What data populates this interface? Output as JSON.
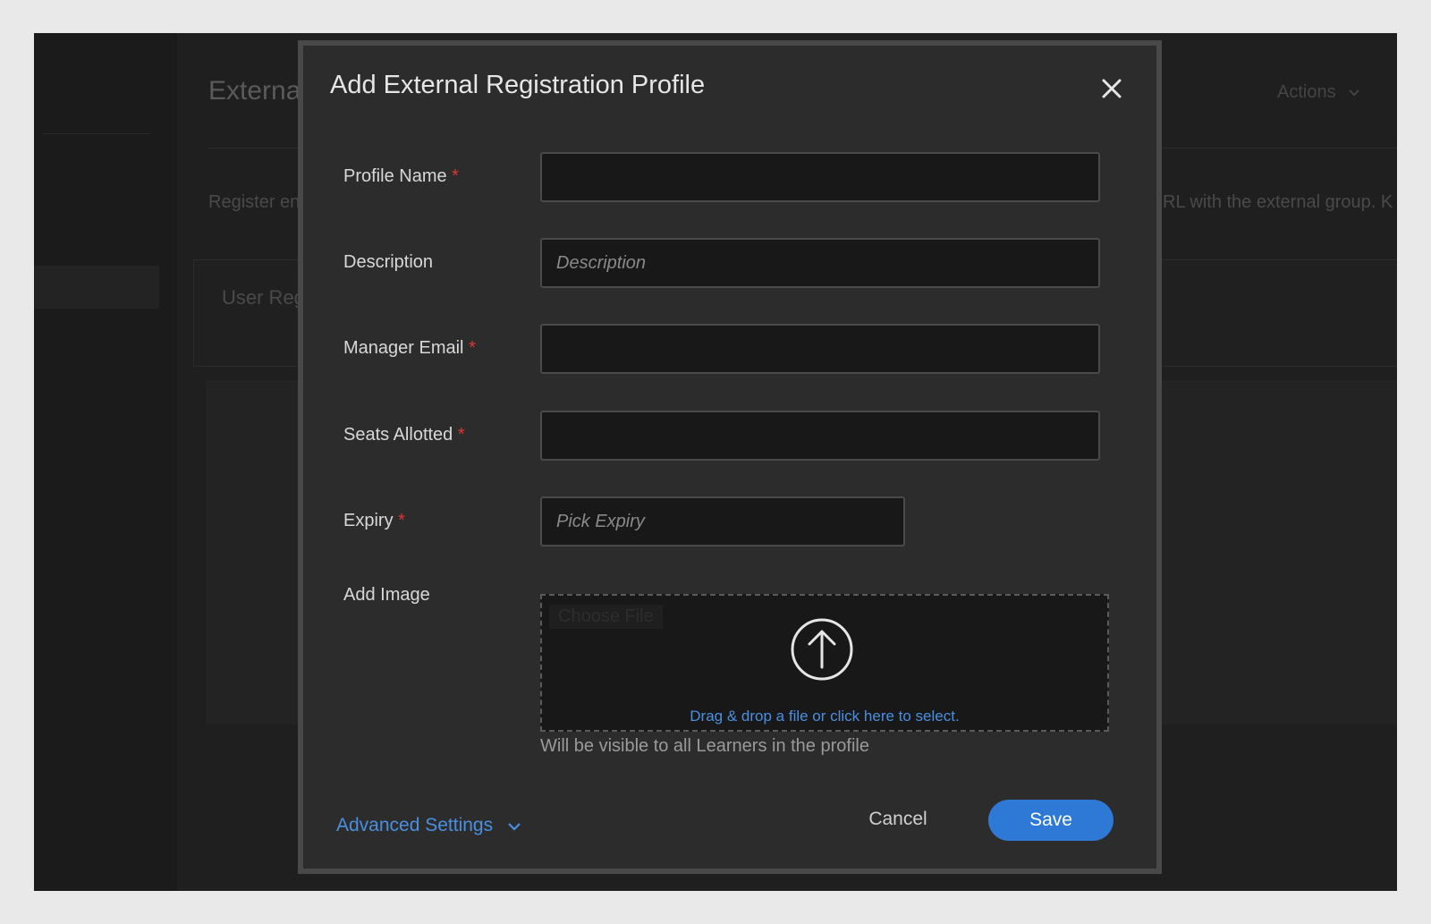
{
  "background": {
    "title": "Externa",
    "actions_label": "Actions",
    "description_left": "Register en",
    "description_right": "RL with the external group. K",
    "card_title": "User Reg"
  },
  "modal": {
    "title": "Add External Registration Profile",
    "close_icon": "close-icon",
    "required_marker": "*",
    "fields": {
      "profile_name": {
        "label": "Profile Name",
        "required": true,
        "value": "",
        "placeholder": ""
      },
      "description": {
        "label": "Description",
        "required": false,
        "value": "",
        "placeholder": "Description"
      },
      "manager_email": {
        "label": "Manager Email",
        "required": true,
        "value": "",
        "placeholder": ""
      },
      "seats_allotted": {
        "label": "Seats Allotted",
        "required": true,
        "value": "",
        "placeholder": ""
      },
      "expiry": {
        "label": "Expiry",
        "required": true,
        "value": "",
        "placeholder": "Pick Expiry"
      }
    },
    "add_image": {
      "label": "Add Image",
      "choose_file": "Choose File",
      "drop_text": "Drag & drop a file or click here to select.",
      "help_text": "Will be visible to all Learners in the profile",
      "icon": "upload-arrow-icon"
    },
    "footer": {
      "advanced_settings": "Advanced Settings",
      "cancel": "Cancel",
      "save": "Save"
    }
  },
  "colors": {
    "accent": "#2e79d6",
    "link": "#4a8fe0",
    "required": "#e03535",
    "modal_bg": "#2c2c2c",
    "input_bg": "#181818"
  }
}
